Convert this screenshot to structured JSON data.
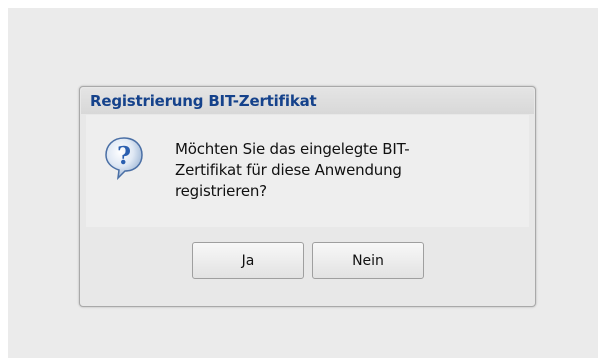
{
  "dialog": {
    "title": "Registrierung BIT-Zertifikat",
    "icon": "question-icon",
    "message": "Möchten Sie das eingelegte BIT-Zertifikat für diese Anwendung registrieren?",
    "buttons": {
      "yes_label": "Ja",
      "no_label": "Nein"
    }
  },
  "colors": {
    "title": "#15428b",
    "icon_blue": "#2a5fb0",
    "backdrop": "#ebebeb"
  }
}
